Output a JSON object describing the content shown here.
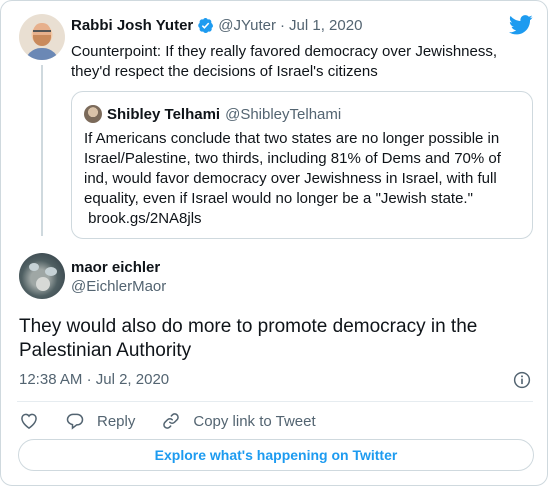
{
  "parent_tweet": {
    "author_name": "Rabbi Josh Yuter",
    "handle": "@JYuter",
    "separator": "·",
    "date": "Jul 1, 2020",
    "text_line1": "Counterpoint: If they really favored democracy over Jewishness,",
    "text_line2": "they'd respect the decisions of Israel's citizens",
    "verified": true
  },
  "quoted_tweet": {
    "author_name": "Shibley Telhami",
    "handle": "@ShibleyTelhami",
    "lines": [
      "If Americans conclude that two states are no longer possible in",
      "Israel/Palestine, two thirds, including 81% of Dems and 70% of",
      "ind, would favor democracy over Jewishness in Israel, with full",
      "equality, even if Israel would no longer be a \"Jewish state.\"",
      " brook.gs/2NA8jls"
    ]
  },
  "main_tweet": {
    "author_name": "maor eichler",
    "handle": "@EichlerMaor",
    "text_line1": "They would also do more to promote democracy in the",
    "text_line2": "Palestinian Authority",
    "time": "12:38 AM",
    "separator": "·",
    "date": "Jul 2, 2020"
  },
  "actions": {
    "reply_label": "Reply",
    "copy_link_label": "Copy link to Tweet"
  },
  "explore_label": "Explore what's happening on Twitter",
  "colors": {
    "accent": "#1d9bf0",
    "muted": "#536471",
    "border": "#cfd9de",
    "text": "#0f1419"
  },
  "icons": [
    "twitter-bird-icon",
    "verified-badge-icon",
    "info-icon",
    "heart-icon",
    "reply-icon",
    "copy-link-icon"
  ]
}
